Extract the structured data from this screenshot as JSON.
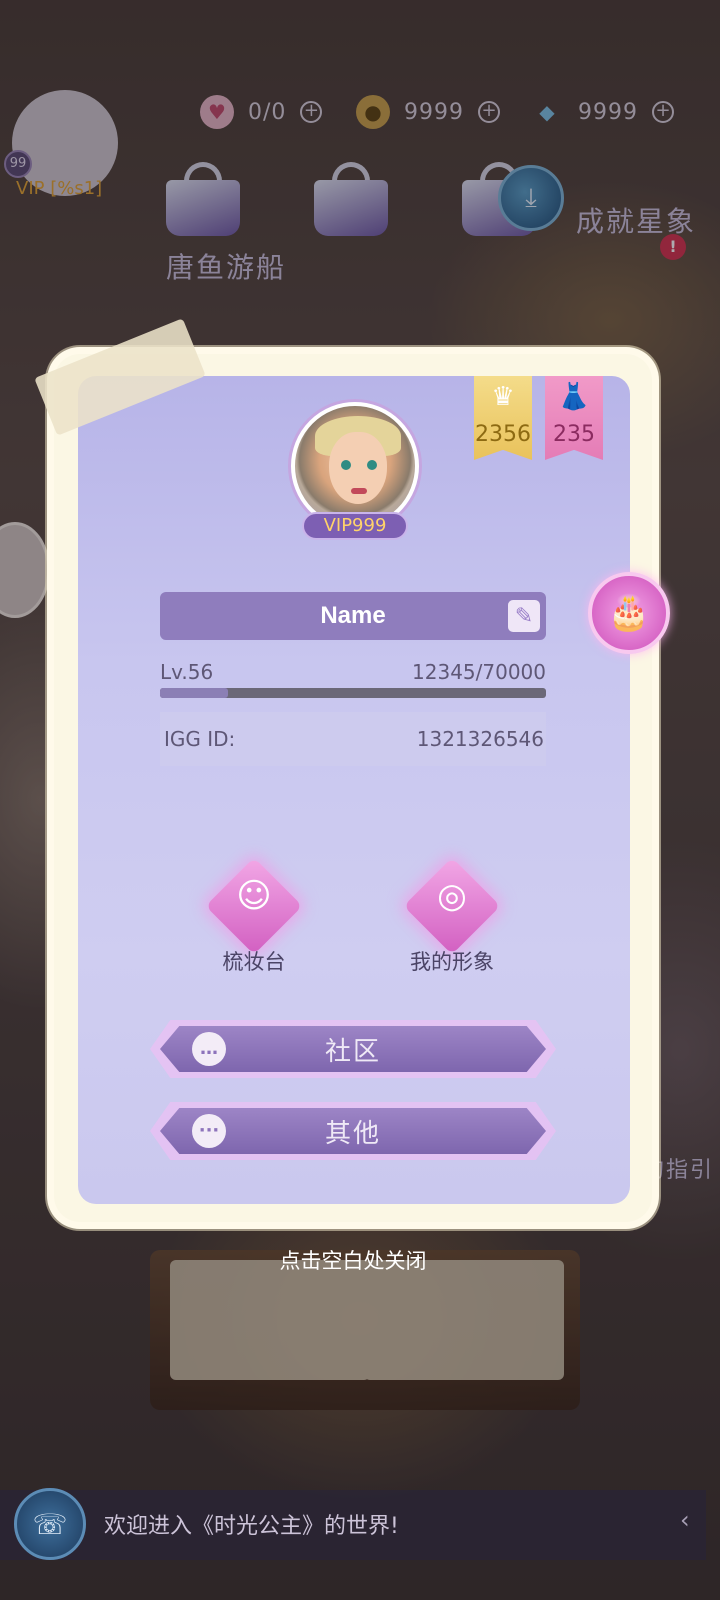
{
  "hud": {
    "hearts": {
      "icon": "heart-icon",
      "value": "0/0"
    },
    "gold": {
      "icon": "gold-coin-icon",
      "value": "9999"
    },
    "diamonds": {
      "icon": "diamond-icon",
      "value": "9999"
    },
    "player_level_badge": "99",
    "player_vip": "VIP [%s1]"
  },
  "scene": {
    "label_left": "唐鱼游船",
    "label_right": "成就星象",
    "alert_mark": "!",
    "right_partial_label": "的指引"
  },
  "profile": {
    "crown_count": "2356",
    "dress_count": "235",
    "vip_tag": "VIP999",
    "name": "Name",
    "level": "Lv.56",
    "xp": "12345/70000",
    "xp_progress": 0.176,
    "id_label": "IGG ID:",
    "id_value": "1321326546"
  },
  "actions": {
    "dresser_label": "梳妆台",
    "my_image_label": "我的形象",
    "community_label": "社区",
    "other_label": "其他"
  },
  "close_hint": "点击空白处关闭",
  "chat": {
    "message": "欢迎进入《时光公主》的世界!"
  },
  "colors": {
    "card_bg": "#c8c6ef",
    "accent_purple": "#8f7dbd",
    "gold_ribbon": "#e9c25b",
    "pink_ribbon": "#e47cb6"
  }
}
